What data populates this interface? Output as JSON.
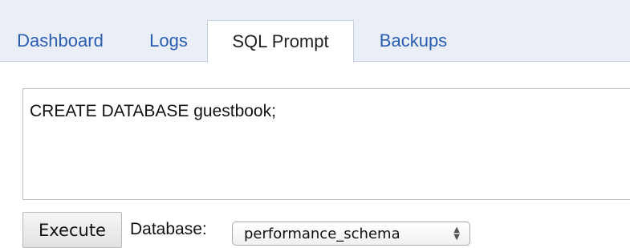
{
  "tabs": [
    {
      "label": "Dashboard",
      "active": false
    },
    {
      "label": "Logs",
      "active": false
    },
    {
      "label": "SQL Prompt",
      "active": true
    },
    {
      "label": "Backups",
      "active": false
    }
  ],
  "sql_prompt": {
    "query": "CREATE DATABASE guestbook;",
    "execute_label": "Execute",
    "database_label": "Database:",
    "database_selected": "performance_schema"
  },
  "icons": {
    "select_arrows": "up-down-chevron-icon"
  },
  "colors": {
    "tab_link": "#2a5db0",
    "tabbar_bg": "#e9eef7"
  }
}
